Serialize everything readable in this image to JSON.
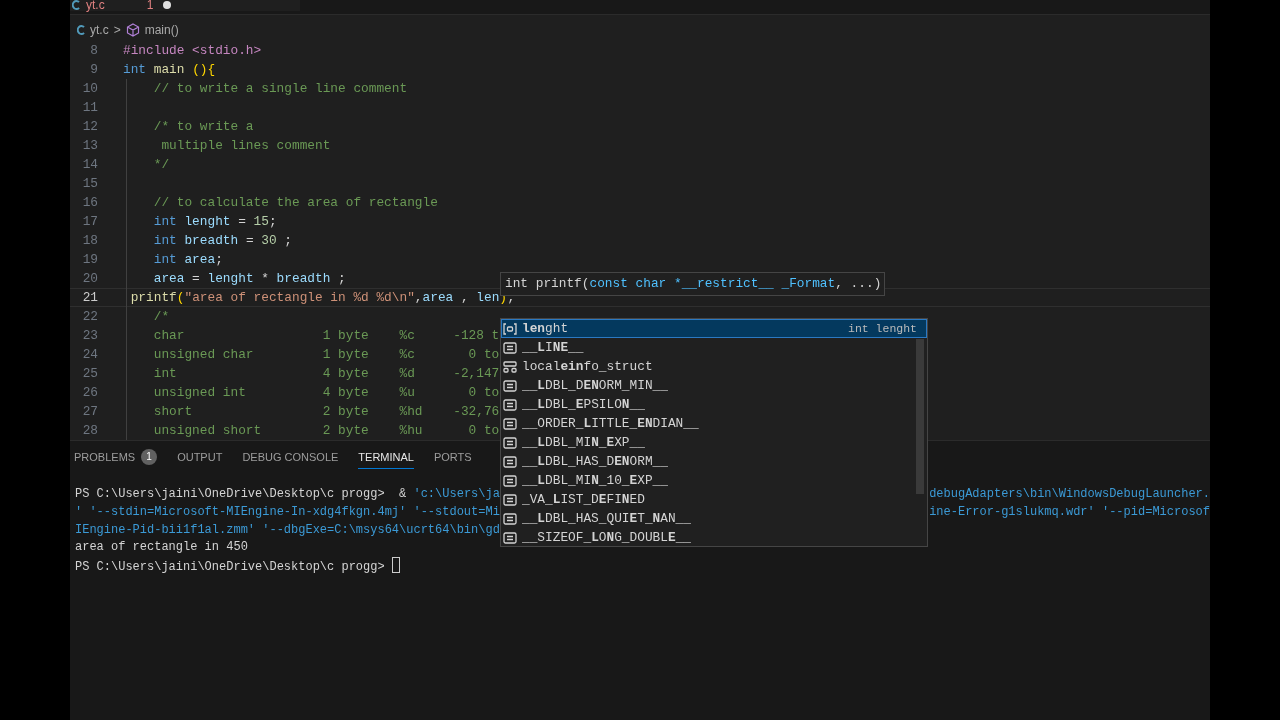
{
  "tabs": [
    {
      "label": "yt.c",
      "problems": "1",
      "modified": true,
      "selected": true
    }
  ],
  "breadcrumb": {
    "file": "yt.c",
    "separator": ">",
    "symbol": "main()"
  },
  "code_lines": [
    {
      "number": "8",
      "current": false,
      "tokens": [
        {
          "text": "#include <stdio.h>",
          "kind": "preprocessor"
        }
      ]
    },
    {
      "number": "9",
      "current": false,
      "tokens": [
        {
          "text": "int",
          "kind": "keyword"
        },
        {
          "text": " main ",
          "kind": "function"
        },
        {
          "text": "(){",
          "kind": "bracket"
        }
      ]
    },
    {
      "number": "10",
      "current": false,
      "tokens": [
        {
          "text": "    // to write a single line comment",
          "kind": "comment"
        }
      ]
    },
    {
      "number": "11",
      "current": false
    },
    {
      "number": "12",
      "current": false,
      "tokens": [
        {
          "text": "    /* to write a",
          "kind": "comment"
        }
      ]
    },
    {
      "number": "13",
      "current": false,
      "tokens": [
        {
          "text": "     multiple lines comment",
          "kind": "comment"
        }
      ]
    },
    {
      "number": "14",
      "current": false,
      "tokens": [
        {
          "text": "    */",
          "kind": "comment"
        }
      ]
    },
    {
      "number": "15",
      "current": false
    },
    {
      "number": "16",
      "current": false,
      "tokens": [
        {
          "text": "    // to calculate the area of rectangle",
          "kind": "comment"
        }
      ]
    },
    {
      "number": "17",
      "current": false,
      "tokens": [
        {
          "text": "    int",
          "kind": "keyword"
        },
        {
          "text": " lenght",
          "kind": "variable"
        },
        {
          "text": " = ",
          "kind": "plain"
        },
        {
          "text": "15",
          "kind": "number"
        },
        {
          "text": ";",
          "kind": "plain"
        }
      ]
    },
    {
      "number": "18",
      "current": false,
      "tokens": [
        {
          "text": "    int",
          "kind": "keyword"
        },
        {
          "text": " breadth",
          "kind": "variable"
        },
        {
          "text": " = ",
          "kind": "plain"
        },
        {
          "text": "30",
          "kind": "number"
        },
        {
          "text": " ;",
          "kind": "plain"
        }
      ]
    },
    {
      "number": "19",
      "current": false,
      "tokens": [
        {
          "text": "    int",
          "kind": "keyword"
        },
        {
          "text": " area",
          "kind": "variable"
        },
        {
          "text": ";",
          "kind": "plain"
        }
      ]
    },
    {
      "number": "20",
      "current": false,
      "tokens": [
        {
          "text": "    area",
          "kind": "variable"
        },
        {
          "text": " = ",
          "kind": "plain"
        },
        {
          "text": "lenght",
          "kind": "variable"
        },
        {
          "text": " * ",
          "kind": "plain"
        },
        {
          "text": "breadth",
          "kind": "variable"
        },
        {
          "text": " ;",
          "kind": "plain"
        }
      ]
    },
    {
      "number": "21",
      "current": true,
      "tokens": [
        {
          "text": " printf",
          "kind": "function"
        },
        {
          "text": "(",
          "kind": "bracket"
        },
        {
          "text": "\"area of rectangle in %d %d\\n\"",
          "kind": "string"
        },
        {
          "text": ",",
          "kind": "plain"
        },
        {
          "text": "area",
          "kind": "variable"
        },
        {
          "text": " , ",
          "kind": "plain"
        },
        {
          "text": "len",
          "kind": "variable"
        },
        {
          "text": ")",
          "kind": "bracket"
        },
        {
          "text": ";",
          "kind": "plain"
        }
      ]
    },
    {
      "number": "22",
      "current": false,
      "tokens": [
        {
          "text": "    /*",
          "kind": "comment"
        }
      ]
    },
    {
      "number": "23",
      "current": false,
      "tokens": [
        {
          "text": "    char                  1 byte    %c     -128 t",
          "kind": "comment"
        }
      ]
    },
    {
      "number": "24",
      "current": false,
      "tokens": [
        {
          "text": "    unsigned char         1 byte    %c       0 to",
          "kind": "comment"
        }
      ]
    },
    {
      "number": "25",
      "current": false,
      "tokens": [
        {
          "text": "    int                   4 byte    %d     -2,147",
          "kind": "comment"
        }
      ]
    },
    {
      "number": "26",
      "current": false,
      "tokens": [
        {
          "text": "    unsigned int          4 byte    %u       0 to",
          "kind": "comment"
        }
      ]
    },
    {
      "number": "27",
      "current": false,
      "tokens": [
        {
          "text": "    short                 2 byte    %hd    -32,76",
          "kind": "comment"
        }
      ]
    },
    {
      "number": "28",
      "current": false,
      "tokens": [
        {
          "text": "    unsigned short        2 byte    %hu      0 to",
          "kind": "comment"
        }
      ]
    }
  ],
  "hover": {
    "tokens": [
      {
        "text": "int printf(",
        "kind": "plain"
      },
      {
        "text": "const char *__restrict__ _Format",
        "kind": "param"
      },
      {
        "text": ", ...)",
        "kind": "plain"
      }
    ]
  },
  "suggestions": [
    {
      "label": "**len**ght",
      "kind": "variable",
      "detail": "int lenght",
      "selected": true
    },
    {
      "label": "__**L**I**NE**__",
      "kind": "constant",
      "selected": false
    },
    {
      "label": "local**ein**fo_struct",
      "kind": "struct",
      "selected": false
    },
    {
      "label": "__**L**DBL_D**EN**ORM_MIN__",
      "kind": "constant",
      "selected": false
    },
    {
      "label": "__**L**DBL_**E**PSILO**N**__",
      "kind": "constant",
      "selected": false
    },
    {
      "label": "__ORDER_**L**ITTLE_**EN**DIAN__",
      "kind": "constant",
      "selected": false
    },
    {
      "label": "__**L**DBL_MI**N**_**E**XP__",
      "kind": "constant",
      "selected": false
    },
    {
      "label": "__**L**DBL_HAS_D**EN**ORM__",
      "kind": "constant",
      "selected": false
    },
    {
      "label": "__**L**DBL_MI**N**_10_**E**XP__",
      "kind": "constant",
      "selected": false
    },
    {
      "label": "_VA_**L**IST_D**E**FI**N**ED",
      "kind": "constant",
      "selected": false
    },
    {
      "label": "__**L**DBL_HAS_QUI**E**T_**N**AN__",
      "kind": "constant",
      "selected": false
    },
    {
      "label": "__SIZEOF_**L**O**N**G_DOUBL**E**__",
      "kind": "constant",
      "selected": false
    }
  ],
  "panel_tabs": [
    {
      "label": "PROBLEMS",
      "badge": "1",
      "selected": false
    },
    {
      "label": "OUTPUT",
      "selected": false
    },
    {
      "label": "DEBUG CONSOLE",
      "selected": false
    },
    {
      "label": "TERMINAL",
      "selected": true
    },
    {
      "label": "PORTS",
      "selected": false
    }
  ],
  "terminal_lines": [
    {
      "left": [
        {
          "text": "PS C:\\Users\\jaini\\OneDrive\\Desktop\\c progg>  & ",
          "kind": "plain"
        },
        {
          "text": "'c:\\Users\\ja",
          "kind": "path"
        }
      ],
      "right": [
        {
          "text": "debugAdapters\\bin\\WindowsDebugLauncher.",
          "kind": "path"
        }
      ]
    },
    {
      "left": [
        {
          "text": "' '--stdin=Microsoft-MIEngine-In-xdg4fkgn.4mj' '--stdout=Mi",
          "kind": "path"
        }
      ],
      "right": [
        {
          "text": "ine-Error-g1slukmq.wdr' '--pid=Microsof",
          "kind": "path"
        }
      ]
    },
    {
      "left": [
        {
          "text": "IEngine-Pid-bii1f1al.zmm' '--dbgExe=C:\\msys64\\ucrt64\\bin\\gd",
          "kind": "path"
        }
      ]
    },
    {
      "left": [
        {
          "text": "area of rectangle in 450",
          "kind": "plain"
        }
      ]
    },
    {
      "left": [
        {
          "text": "PS C:\\Users\\jaini\\OneDrive\\Desktop\\c progg> ",
          "kind": "plain"
        }
      ],
      "cursor": true
    }
  ]
}
